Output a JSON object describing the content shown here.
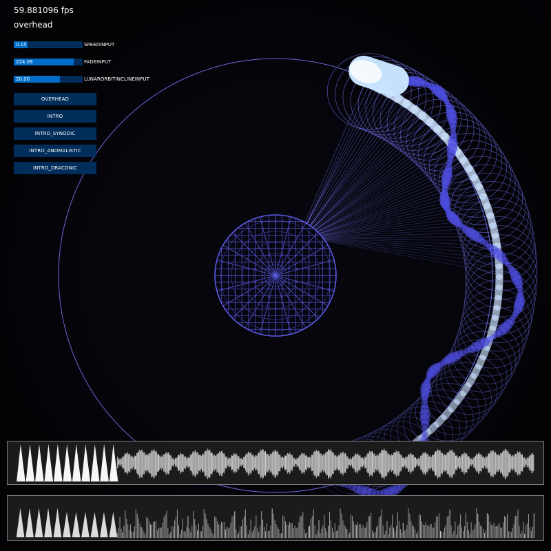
{
  "hud": {
    "fps_text": "59.881096 fps",
    "mode_text": "overhead"
  },
  "controls": {
    "speed": {
      "label": "SPEEDINPUT",
      "value_text": "0.15",
      "fill_fraction": 0.2
    },
    "fade": {
      "label": "FADEINPUT",
      "value_text": "224.09",
      "fill_fraction": 0.87
    },
    "lunar": {
      "label": "LUNARORBITINCLINEINPUT",
      "value_text": "20.00",
      "fill_fraction": 0.67
    }
  },
  "buttons": {
    "overhead": "OVERHEAD",
    "intro": "INTRO",
    "intro_synodic": "INTRO_SYNODIC",
    "intro_anomalistic": "INTRO_ANOMALISTIC",
    "intro_draconic": "INTRO_DRACONIC"
  },
  "colors": {
    "background": "#020208",
    "orbit_blue": "#6e6ee6",
    "mesh_blue": "#5c5ce8",
    "moon_trail": "#c9e6ff",
    "slider_track": "#002d5a",
    "slider_fill": "#006ec8",
    "panel_border": "#7f7f7f",
    "panel_background": "#1b1b1b"
  }
}
